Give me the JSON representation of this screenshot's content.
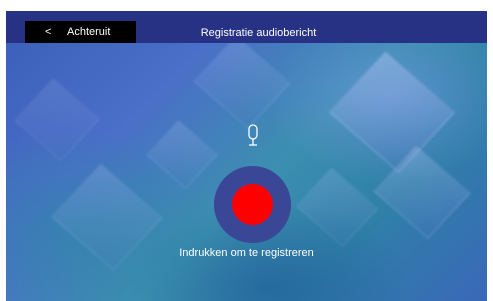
{
  "header": {
    "back_label": "Achteruit",
    "back_chevron": "<",
    "title": "Registratie audiobericht"
  },
  "main": {
    "mic_icon": "microphone-icon",
    "record_icon": "record-icon",
    "hint": "Indrukken om te registreren"
  },
  "colors": {
    "header_bg": "#283284",
    "back_button_bg": "#000000",
    "record_ring": "#3a4696",
    "record_dot": "#ff0000"
  }
}
